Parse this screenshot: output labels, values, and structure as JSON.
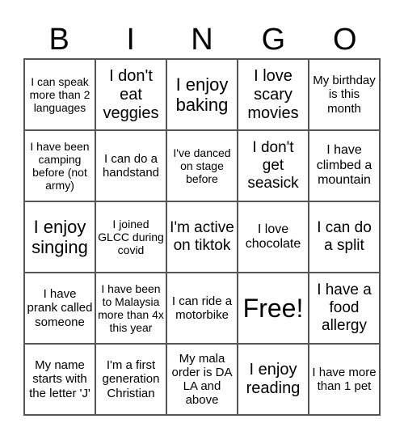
{
  "header": [
    "B",
    "I",
    "N",
    "G",
    "O"
  ],
  "cells": [
    [
      "I can speak more than 2 languages",
      "I don't eat veggies",
      "I enjoy baking",
      "I love scary movies",
      "My birthday is this month"
    ],
    [
      "I have been camping before (not army)",
      "I can do a handstand",
      "I've danced on stage before",
      "I don't get seasick",
      "I have climbed a mountain"
    ],
    [
      "I enjoy singing",
      "I joined GLCC during covid",
      "I'm active on tiktok",
      "I love chocolate",
      "I can do a split"
    ],
    [
      "I have prank called someone",
      "I have been to Malaysia more than 4x this year",
      "I can ride a motorbike",
      "Free!",
      "I have a food allergy"
    ],
    [
      "My name starts with the letter 'J'",
      "I'm a first generation Christian",
      "My mala order is DA LA and above",
      "I enjoy reading",
      "I have more than 1 pet"
    ]
  ]
}
